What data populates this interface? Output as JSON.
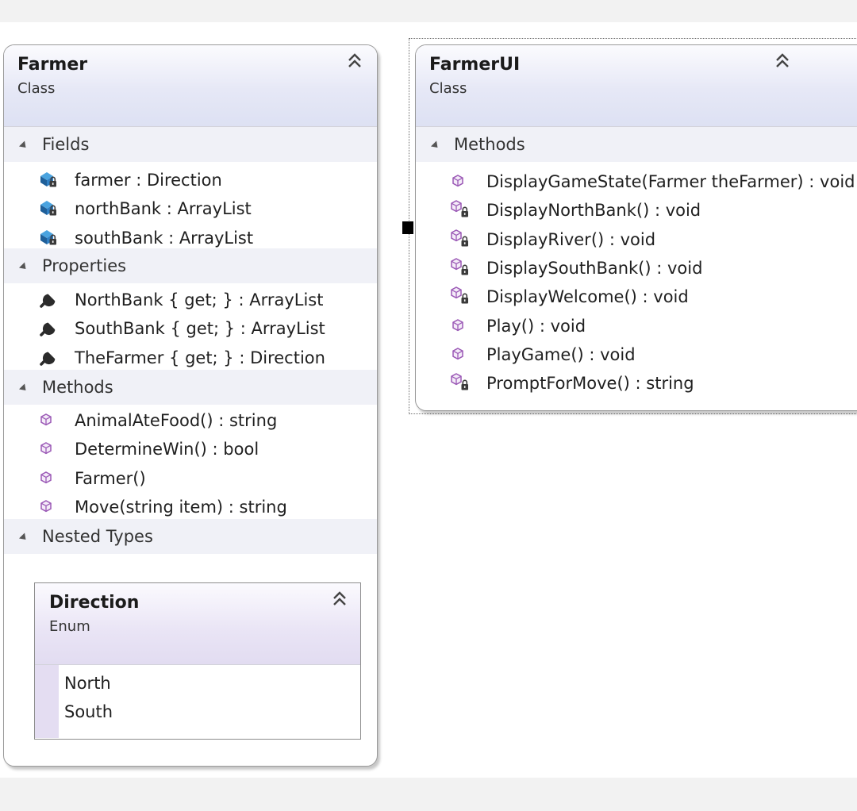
{
  "farmer_class": {
    "title": "Farmer",
    "kind": "Class",
    "sections": {
      "fields": {
        "label": "Fields",
        "items": [
          {
            "text": "farmer : Direction",
            "icon": "private-field-icon"
          },
          {
            "text": "northBank : ArrayList",
            "icon": "private-field-icon"
          },
          {
            "text": "southBank : ArrayList",
            "icon": "private-field-icon"
          }
        ]
      },
      "properties": {
        "label": "Properties",
        "items": [
          {
            "text": "NorthBank { get; } : ArrayList",
            "icon": "wrench-property-icon"
          },
          {
            "text": "SouthBank { get; } : ArrayList",
            "icon": "wrench-property-icon"
          },
          {
            "text": "TheFarmer { get; } : Direction",
            "icon": "wrench-property-icon"
          }
        ]
      },
      "methods": {
        "label": "Methods",
        "items": [
          {
            "text": "AnimalAteFood() : string",
            "icon": "public-method-icon"
          },
          {
            "text": "DetermineWin() : bool",
            "icon": "public-method-icon"
          },
          {
            "text": "Farmer()",
            "icon": "public-method-icon"
          },
          {
            "text": "Move(string item) : string",
            "icon": "public-method-icon"
          }
        ]
      },
      "nested_types": {
        "label": "Nested Types"
      }
    },
    "nested_enum": {
      "title": "Direction",
      "kind": "Enum",
      "values": [
        "North",
        "South"
      ]
    }
  },
  "farmerui_class": {
    "title": "FarmerUI",
    "kind": "Class",
    "sections": {
      "methods": {
        "label": "Methods",
        "items": [
          {
            "text": "DisplayGameState(Farmer theFarmer) : void",
            "icon": "public-method-icon"
          },
          {
            "text": "DisplayNorthBank() : void",
            "icon": "private-method-icon"
          },
          {
            "text": "DisplayRiver() : void",
            "icon": "private-method-icon"
          },
          {
            "text": "DisplaySouthBank() : void",
            "icon": "private-method-icon"
          },
          {
            "text": "DisplayWelcome() : void",
            "icon": "private-method-icon"
          },
          {
            "text": "Play() : void",
            "icon": "public-method-icon"
          },
          {
            "text": "PlayGame() : void",
            "icon": "public-method-icon"
          },
          {
            "text": "PromptForMove() : string",
            "icon": "private-method-icon"
          }
        ]
      }
    }
  },
  "colors": {
    "field_icon": "#1f6fb2",
    "method_icon": "#9b59b6",
    "header_gradient_end": "#dde1f3",
    "enum_strip": "#e4ddf2"
  }
}
